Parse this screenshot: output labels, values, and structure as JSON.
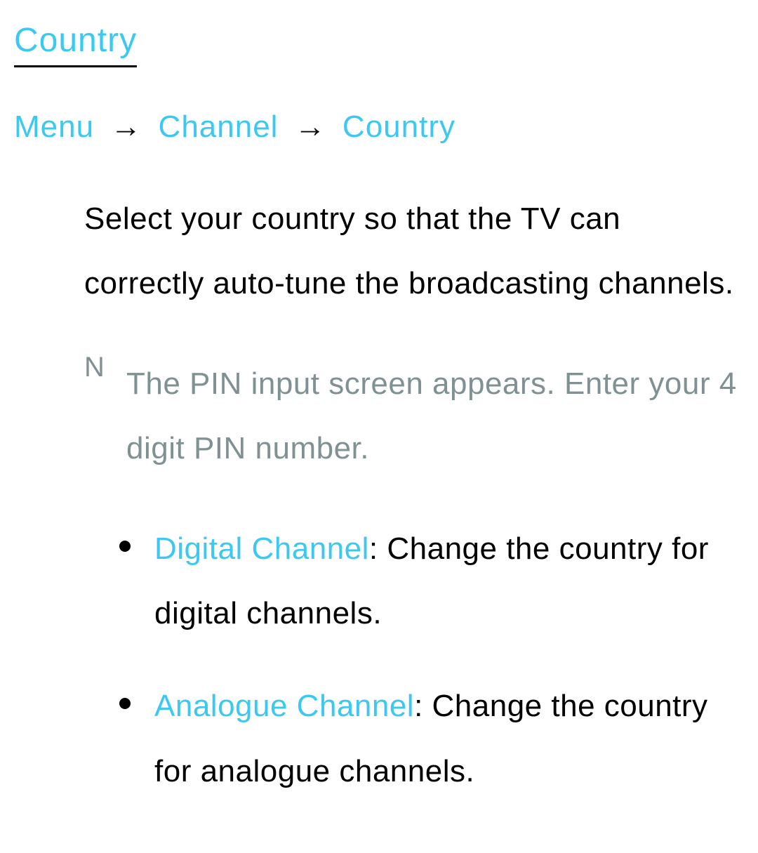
{
  "title": "Country",
  "breadcrumb": {
    "items": [
      "Menu",
      "Channel",
      "Country"
    ],
    "separator": "→"
  },
  "intro": "Select your country so that the TV can correctly auto-tune the broadcasting channels.",
  "note": {
    "marker": "N",
    "text": "The PIN input screen appears. Enter your 4 digit PIN number."
  },
  "options": [
    {
      "label": "Digital Channel",
      "description": ": Change the country for digital channels."
    },
    {
      "label": "Analogue Channel",
      "description": ": Change the country for analogue channels."
    }
  ]
}
